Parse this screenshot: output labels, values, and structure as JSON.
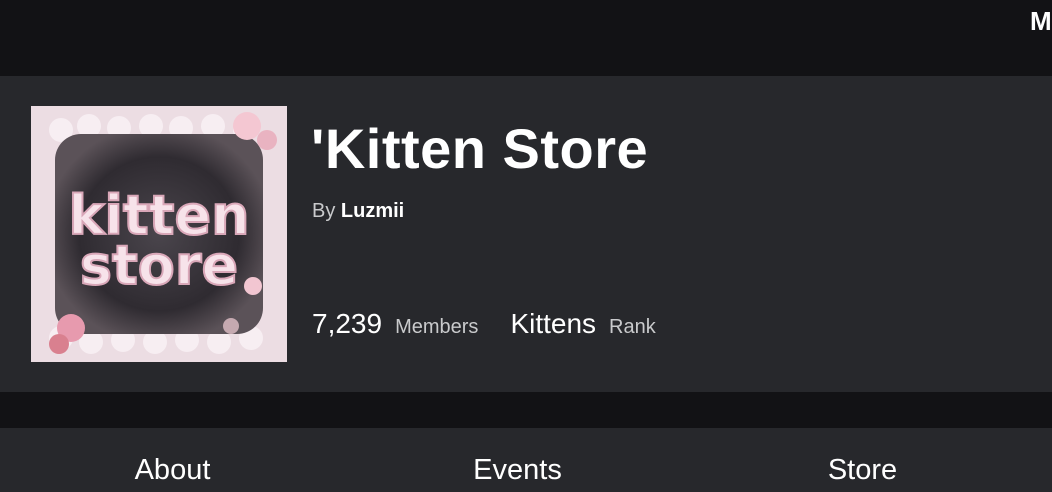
{
  "topbar": {
    "overflow_text": "M"
  },
  "group": {
    "icon_name": "group-icon",
    "icon_text_line1": "kitten",
    "icon_text_line2": "store",
    "title": "'Kitten Store",
    "byline_prefix": "By",
    "owner": "Luzmii",
    "members_count": "7,239",
    "members_label": "Members",
    "rank_value": "Kittens",
    "rank_label": "Rank"
  },
  "tabs": [
    {
      "label": "About"
    },
    {
      "label": "Events"
    },
    {
      "label": "Store"
    }
  ],
  "colors": {
    "background": "#121215",
    "card": "#27282c",
    "text_primary": "#ffffff",
    "text_secondary": "#c9cacc",
    "icon_pink": "#ecdde3"
  }
}
